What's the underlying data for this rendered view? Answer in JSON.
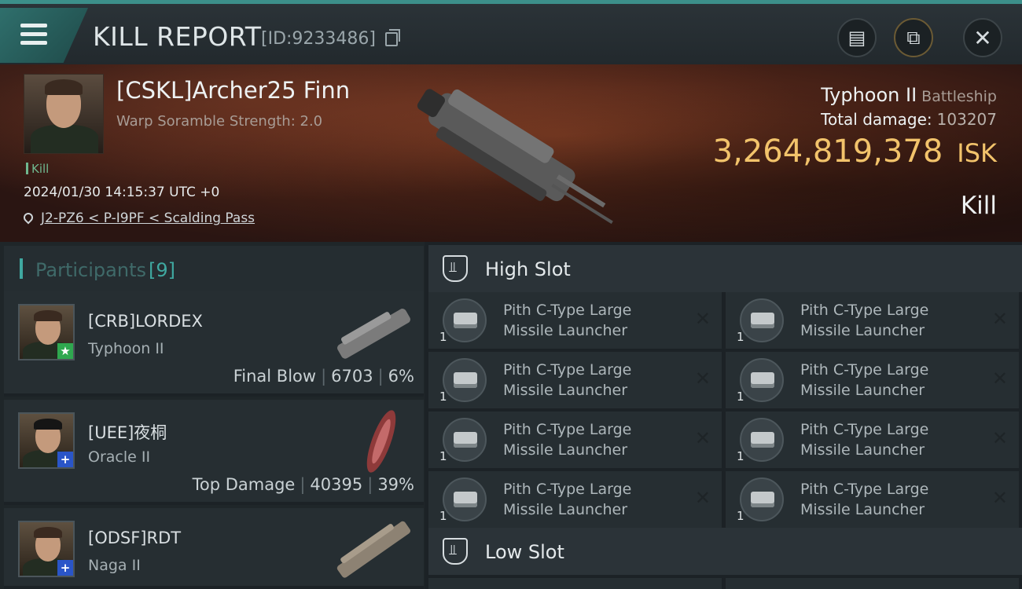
{
  "header": {
    "title": "KILL REPORT",
    "report_id": "[ID:9233486]",
    "icons": [
      "menu-icon",
      "copy-icon",
      "clipboard-icon",
      "share-icon",
      "close-icon"
    ]
  },
  "victim": {
    "name": "[CSKL]Archer25 Finn",
    "warp_scramble": "Warp Soramble Strength: 2.0",
    "tag": "Kill",
    "datetime": "2024/01/30 14:15:37 UTC +0",
    "location": "J2-PZ6 < P-I9PF < Scalding Pass",
    "ship": "Typhoon II",
    "ship_class": "Battleship",
    "total_damage_label": "Total damage:",
    "total_damage": "103207",
    "isk_value": "3,264,819,378",
    "isk_unit": "ISK",
    "result": "Kill"
  },
  "participants": {
    "title": "Participants",
    "count": "[9]",
    "rows": [
      {
        "name": "[CRB]LORDEX",
        "ship": "Typhoon II",
        "label": "Final Blow",
        "damage": "6703",
        "percent": "6%",
        "badge": "★",
        "badge_color": "#2fa84f"
      },
      {
        "name": "[UEE]夜桐",
        "ship": "Oracle II",
        "label": "Top Damage",
        "damage": "40395",
        "percent": "39%",
        "badge": "+",
        "badge_color": "#2a55c8"
      },
      {
        "name": "[ODSF]RDT",
        "ship": "Naga II",
        "label": "",
        "damage": "",
        "percent": "",
        "badge": "+",
        "badge_color": "#2a55c8"
      }
    ]
  },
  "slots": {
    "high": {
      "title": "High Slot",
      "modules": [
        {
          "line1": "Pith C-Type Large",
          "line2": "Missile Launcher",
          "qty": "1"
        },
        {
          "line1": "Pith C-Type Large",
          "line2": "Missile Launcher",
          "qty": "1"
        },
        {
          "line1": "Pith C-Type Large",
          "line2": "Missile Launcher",
          "qty": "1"
        },
        {
          "line1": "Pith C-Type Large",
          "line2": "Missile Launcher",
          "qty": "1"
        },
        {
          "line1": "Pith C-Type Large",
          "line2": "Missile Launcher",
          "qty": "1"
        },
        {
          "line1": "Pith C-Type Large",
          "line2": "Missile Launcher",
          "qty": "1"
        },
        {
          "line1": "Pith C-Type Large",
          "line2": "Missile Launcher",
          "qty": "1"
        },
        {
          "line1": "Pith C-Type Large",
          "line2": "Missile Launcher",
          "qty": "1"
        }
      ]
    },
    "low": {
      "title": "Low Slot"
    }
  },
  "colors": {
    "accent_teal": "#3fa8a0",
    "isk_gold": "#f2c36b",
    "banner_red": "#7a3a22"
  }
}
